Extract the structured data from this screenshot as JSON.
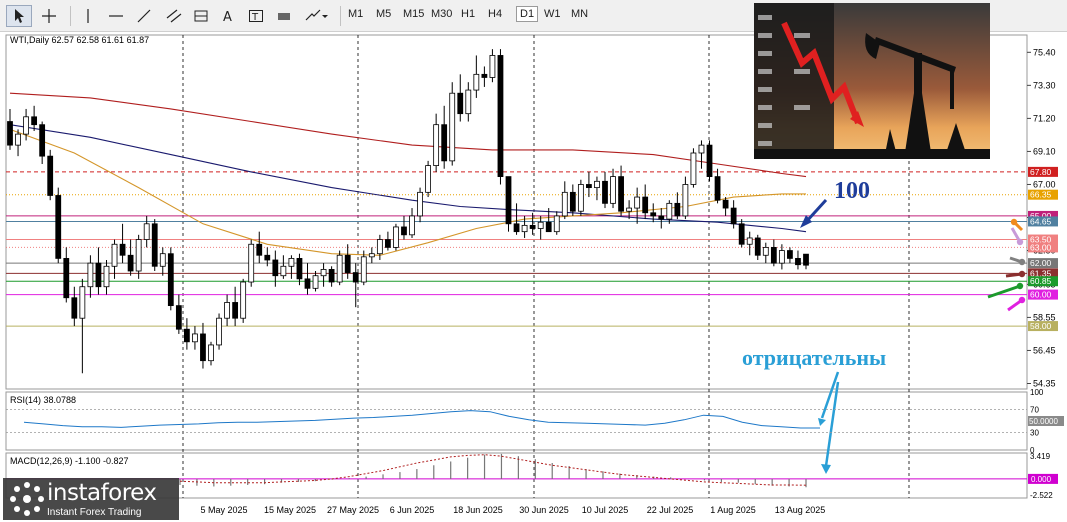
{
  "toolbar": {
    "timeframes": [
      "M1",
      "M5",
      "M15",
      "M30",
      "H1",
      "H4",
      "D1",
      "W1",
      "MN"
    ],
    "active_timeframe": "D1"
  },
  "chart": {
    "symbol_line": "WTI,Daily  62.57 62.58 61.61 61.87",
    "rsi_label": "RSI(14) 38.0788",
    "macd_label": "MACD(12,26,9) -1.100 -0.827"
  },
  "annotations": {
    "ma_label": "100",
    "negative_label": "отрицательны"
  },
  "logo": {
    "name": "instaforex",
    "tagline": "Instant Forex Trading"
  },
  "colors": {
    "bull": "#ffffff",
    "bear": "#000000",
    "ma_red": "#b01e1e",
    "ma_navy": "#1a1a6e",
    "ma_orange": "#d4962a",
    "rsi_line": "#1e78c8",
    "macd_signal": "#b01e1e",
    "annotation_blue": "#1f3d9a"
  },
  "chart_data": {
    "type": "candlestick",
    "instrument": "WTI",
    "timeframe": "Daily",
    "x_tick_labels": [
      "5 May 2025",
      "15 May 2025",
      "27 May 2025",
      "6 Jun 2025",
      "18 Jun 2025",
      "30 Jun 2025",
      "10 Jul 2025",
      "22 Jul 2025",
      "1 Aug 2025",
      "13 Aug 2025"
    ],
    "price_axis": {
      "ticks": [
        "75.40",
        "73.30",
        "71.20",
        "69.10",
        "67.00",
        "64.90",
        "62.80",
        "60.65",
        "58.55",
        "56.45",
        "54.35"
      ],
      "range": [
        54.0,
        76.5
      ]
    },
    "last_ohlc": {
      "open": 62.57,
      "high": 62.58,
      "low": 61.61,
      "close": 61.87
    },
    "horizontal_levels": [
      {
        "value": "67.80",
        "color": "#d02020",
        "style": "dashed"
      },
      {
        "value": "66.35",
        "color": "#e8a200",
        "style": "dotted"
      },
      {
        "value": "65.00",
        "color": "#c0207a",
        "style": "solid"
      },
      {
        "value": "64.65",
        "color": "#5080a0",
        "style": "solid"
      },
      {
        "value": "63.50",
        "color": "#f08080",
        "style": "solid"
      },
      {
        "value": "63.00",
        "color": "#f08080",
        "style": "dotted"
      },
      {
        "value": "62.00",
        "color": "#777777",
        "style": "solid"
      },
      {
        "value": "61.35",
        "color": "#8b2f2f",
        "style": "solid"
      },
      {
        "value": "60.85",
        "color": "#1c9a2c",
        "style": "solid"
      },
      {
        "value": "60.00",
        "color": "#e020e0",
        "style": "solid"
      },
      {
        "value": "58.00",
        "color": "#b8b060",
        "style": "solid"
      }
    ],
    "candles": [
      [
        71.0,
        71.8,
        69.2,
        69.5
      ],
      [
        69.5,
        70.5,
        68.8,
        70.2
      ],
      [
        70.2,
        71.8,
        69.8,
        71.3
      ],
      [
        71.3,
        72.0,
        70.4,
        70.8
      ],
      [
        70.8,
        71.0,
        68.3,
        68.8
      ],
      [
        68.8,
        69.2,
        66.0,
        66.3
      ],
      [
        66.3,
        66.8,
        62.0,
        62.3
      ],
      [
        62.3,
        63.0,
        59.5,
        59.8
      ],
      [
        59.8,
        60.5,
        58.0,
        58.5
      ],
      [
        58.5,
        61.0,
        55.0,
        60.5
      ],
      [
        60.5,
        62.5,
        59.8,
        62.0
      ],
      [
        62.0,
        63.0,
        60.0,
        60.5
      ],
      [
        60.5,
        62.2,
        60.0,
        61.8
      ],
      [
        61.8,
        63.5,
        61.0,
        63.2
      ],
      [
        63.2,
        64.5,
        62.0,
        62.5
      ],
      [
        62.5,
        63.5,
        61.2,
        61.5
      ],
      [
        61.5,
        63.8,
        61.0,
        63.5
      ],
      [
        63.5,
        65.0,
        63.0,
        64.5
      ],
      [
        64.5,
        64.8,
        61.5,
        61.8
      ],
      [
        61.8,
        63.0,
        61.2,
        62.6
      ],
      [
        62.6,
        63.0,
        59.0,
        59.3
      ],
      [
        59.3,
        60.0,
        57.5,
        57.8
      ],
      [
        57.8,
        58.5,
        56.5,
        57.0
      ],
      [
        57.0,
        58.0,
        56.5,
        57.5
      ],
      [
        57.5,
        58.2,
        55.3,
        55.8
      ],
      [
        55.8,
        57.0,
        55.5,
        56.8
      ],
      [
        56.8,
        58.8,
        56.5,
        58.5
      ],
      [
        58.5,
        60.0,
        58.0,
        59.5
      ],
      [
        59.5,
        60.5,
        58.0,
        58.5
      ],
      [
        58.5,
        61.0,
        58.2,
        60.8
      ],
      [
        60.8,
        63.5,
        60.5,
        63.2
      ],
      [
        63.2,
        64.0,
        62.0,
        62.5
      ],
      [
        62.5,
        63.0,
        61.8,
        62.2
      ],
      [
        62.2,
        62.8,
        60.5,
        61.2
      ],
      [
        61.2,
        62.5,
        61.0,
        61.8
      ],
      [
        61.8,
        62.5,
        61.0,
        62.3
      ],
      [
        62.3,
        62.6,
        60.6,
        61.0
      ],
      [
        61.0,
        62.0,
        60.0,
        60.4
      ],
      [
        60.4,
        61.5,
        60.2,
        61.2
      ],
      [
        61.2,
        62.0,
        60.5,
        61.6
      ],
      [
        61.6,
        61.8,
        60.5,
        60.8
      ],
      [
        60.8,
        62.8,
        60.6,
        62.5
      ],
      [
        62.5,
        63.2,
        61.0,
        61.4
      ],
      [
        61.4,
        62.0,
        59.2,
        60.8
      ],
      [
        60.8,
        62.8,
        60.6,
        62.4
      ],
      [
        62.4,
        63.0,
        62.0,
        62.6
      ],
      [
        62.6,
        63.8,
        62.2,
        63.5
      ],
      [
        63.5,
        64.0,
        62.8,
        63.0
      ],
      [
        63.0,
        64.5,
        62.8,
        64.3
      ],
      [
        64.3,
        65.0,
        63.5,
        63.8
      ],
      [
        63.8,
        65.5,
        63.6,
        65.0
      ],
      [
        65.0,
        66.8,
        64.6,
        66.5
      ],
      [
        66.5,
        68.5,
        66.2,
        68.2
      ],
      [
        68.2,
        71.5,
        67.8,
        70.8
      ],
      [
        70.8,
        72.0,
        68.0,
        68.5
      ],
      [
        68.5,
        73.5,
        68.2,
        72.8
      ],
      [
        72.8,
        74.0,
        71.0,
        71.5
      ],
      [
        71.5,
        73.5,
        71.0,
        73.0
      ],
      [
        73.0,
        75.2,
        72.5,
        74.0
      ],
      [
        74.0,
        74.5,
        73.2,
        73.8
      ],
      [
        73.8,
        75.6,
        73.5,
        75.2
      ],
      [
        75.2,
        75.6,
        67.0,
        67.5
      ],
      [
        67.5,
        65.5,
        64.0,
        64.5
      ],
      [
        64.5,
        65.8,
        63.8,
        64.0
      ],
      [
        64.0,
        65.0,
        63.6,
        64.4
      ],
      [
        64.4,
        65.2,
        63.8,
        64.2
      ],
      [
        64.2,
        65.0,
        63.5,
        64.6
      ],
      [
        64.6,
        65.5,
        64.0,
        64.0
      ],
      [
        64.0,
        65.3,
        63.8,
        65.0
      ],
      [
        65.0,
        67.2,
        64.8,
        66.5
      ],
      [
        66.5,
        67.0,
        65.0,
        65.3
      ],
      [
        65.3,
        67.3,
        65.0,
        67.0
      ],
      [
        67.0,
        67.8,
        66.2,
        66.8
      ],
      [
        66.8,
        67.5,
        66.0,
        67.2
      ],
      [
        67.2,
        67.8,
        65.5,
        65.8
      ],
      [
        65.8,
        68.0,
        65.5,
        67.5
      ],
      [
        67.5,
        68.2,
        65.0,
        65.3
      ],
      [
        65.3,
        66.0,
        64.8,
        65.5
      ],
      [
        65.5,
        66.8,
        64.5,
        66.2
      ],
      [
        66.2,
        67.0,
        64.8,
        65.2
      ],
      [
        65.2,
        65.8,
        64.6,
        65.0
      ],
      [
        65.0,
        65.5,
        64.2,
        64.8
      ],
      [
        64.8,
        66.0,
        64.5,
        65.8
      ],
      [
        65.8,
        66.5,
        64.8,
        65.0
      ],
      [
        65.0,
        67.5,
        64.8,
        67.0
      ],
      [
        67.0,
        69.3,
        66.8,
        69.0
      ],
      [
        69.0,
        69.8,
        68.0,
        69.5
      ],
      [
        69.5,
        69.8,
        67.2,
        67.5
      ],
      [
        67.5,
        68.0,
        65.8,
        66.0
      ],
      [
        66.0,
        66.2,
        65.0,
        65.5
      ],
      [
        65.5,
        66.0,
        64.2,
        64.5
      ],
      [
        64.5,
        64.8,
        63.0,
        63.2
      ],
      [
        63.2,
        64.0,
        62.5,
        63.6
      ],
      [
        63.6,
        63.8,
        62.2,
        62.5
      ],
      [
        62.5,
        63.3,
        62.0,
        63.0
      ],
      [
        63.0,
        63.5,
        61.8,
        62.0
      ],
      [
        62.0,
        63.2,
        61.6,
        62.8
      ],
      [
        62.8,
        63.0,
        62.0,
        62.3
      ],
      [
        62.3,
        62.8,
        61.6,
        61.9
      ],
      [
        62.57,
        62.58,
        61.61,
        61.87
      ]
    ],
    "moving_averages": [
      {
        "period": "200",
        "color": "#b01e1e",
        "points": [
          [
            0,
            72.8
          ],
          [
            10,
            72.5
          ],
          [
            20,
            71.8
          ],
          [
            30,
            71.0
          ],
          [
            40,
            70.2
          ],
          [
            50,
            69.5
          ],
          [
            60,
            69.2
          ],
          [
            70,
            69.2
          ],
          [
            80,
            68.9
          ],
          [
            88,
            68.3
          ],
          [
            96,
            67.7
          ],
          [
            99,
            67.5
          ]
        ]
      },
      {
        "period": "100",
        "color": "#1a1a6e",
        "points": [
          [
            0,
            70.8
          ],
          [
            10,
            70.0
          ],
          [
            20,
            68.9
          ],
          [
            30,
            67.8
          ],
          [
            40,
            66.8
          ],
          [
            50,
            66.0
          ],
          [
            56,
            65.6
          ],
          [
            62,
            65.4
          ],
          [
            70,
            65.2
          ],
          [
            80,
            64.8
          ],
          [
            88,
            64.6
          ],
          [
            96,
            64.2
          ],
          [
            99,
            64.0
          ]
        ]
      },
      {
        "period": "50",
        "color": "#d4962a",
        "points": [
          [
            0,
            70.5
          ],
          [
            8,
            69.0
          ],
          [
            16,
            66.8
          ],
          [
            24,
            64.5
          ],
          [
            32,
            63.2
          ],
          [
            40,
            62.6
          ],
          [
            46,
            62.5
          ],
          [
            52,
            63.3
          ],
          [
            58,
            64.2
          ],
          [
            64,
            64.8
          ],
          [
            70,
            65.0
          ],
          [
            76,
            65.2
          ],
          [
            84,
            65.6
          ],
          [
            90,
            66.2
          ],
          [
            96,
            66.4
          ],
          [
            99,
            66.4
          ]
        ]
      }
    ],
    "rsi": {
      "period": 14,
      "last": 38.0788,
      "levels": [
        "100",
        "70",
        "30",
        "0"
      ],
      "marker": "50.0000",
      "values": [
        48,
        45,
        42,
        40,
        40,
        39,
        41,
        43,
        44,
        45,
        47,
        48,
        48,
        49,
        50,
        51,
        53,
        55,
        56,
        58,
        60,
        63,
        66,
        68,
        66,
        58,
        52,
        48,
        47,
        46,
        45,
        44,
        43,
        46,
        52,
        60,
        58,
        48,
        42,
        40,
        38,
        38
      ]
    },
    "macd": {
      "params": "12,26,9",
      "value": -1.1,
      "signal_value": -0.827,
      "ticks": [
        "3.419",
        "0.000",
        "-2.522"
      ],
      "histogram": [
        -0.8,
        -0.9,
        -1.0,
        -0.9,
        -0.8,
        -0.7,
        -0.5,
        -0.4,
        -0.3,
        -0.1,
        0.1,
        0.3,
        0.6,
        0.9,
        1.3,
        1.8,
        2.3,
        2.8,
        3.2,
        3.3,
        3.0,
        2.6,
        2.1,
        1.7,
        1.3,
        1.0,
        0.7,
        0.5,
        0.3,
        0.2,
        0.0,
        -0.2,
        -0.4,
        -0.5,
        -0.7,
        -0.9,
        -1.0,
        -1.1
      ],
      "signal": [
        -0.3,
        -0.4,
        -0.5,
        -0.5,
        -0.5,
        -0.5,
        -0.4,
        -0.3,
        -0.2,
        0.0,
        0.3,
        0.7,
        1.1,
        1.6,
        2.1,
        2.5,
        2.9,
        3.1,
        3.2,
        3.0,
        2.6,
        2.2,
        1.8,
        1.5,
        1.2,
        0.9,
        0.6,
        0.4,
        0.2,
        0.0,
        -0.2,
        -0.4,
        -0.5,
        -0.6,
        -0.7,
        -0.8,
        -0.8,
        -0.83
      ]
    }
  }
}
